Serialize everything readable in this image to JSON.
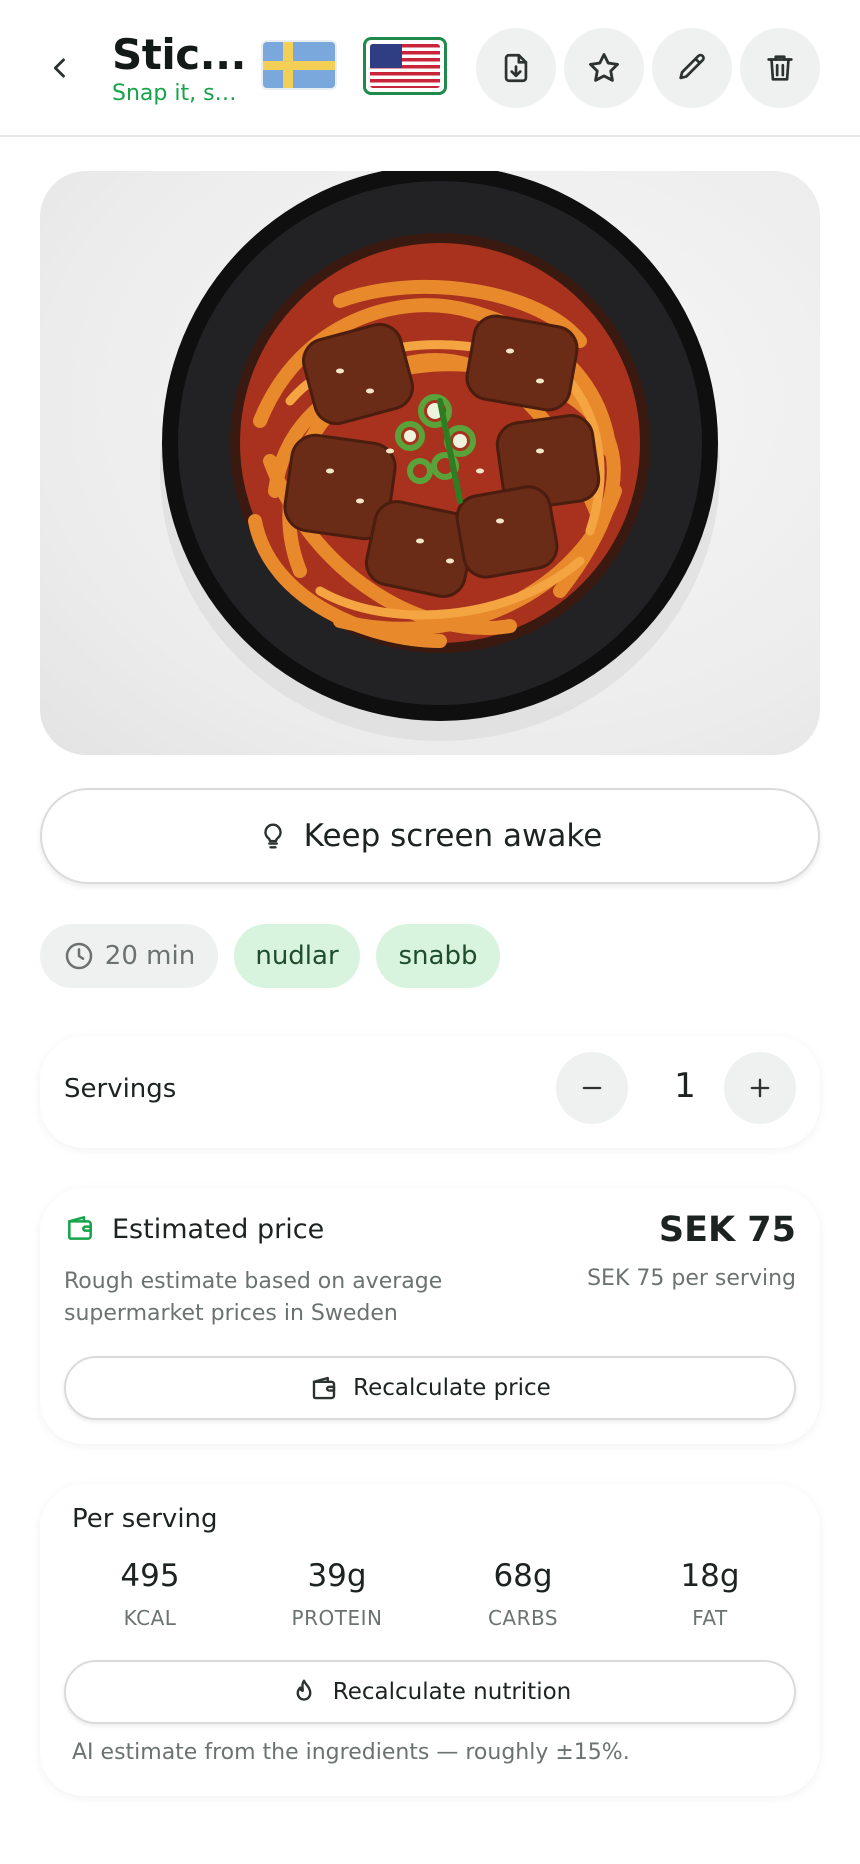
{
  "header": {
    "title": "Stic...",
    "subtitle": "Snap it, sa...",
    "languages": [
      "sv",
      "en-US"
    ],
    "selected_language": "en-US",
    "actions": [
      "download-icon",
      "star-icon",
      "pencil-icon",
      "trash-icon"
    ]
  },
  "hero": {
    "icon": "recipe-photo"
  },
  "awake": {
    "label": "Keep screen awake",
    "icon": "lightbulb-icon"
  },
  "chips": {
    "time": "20 min",
    "tags": [
      "nudlar",
      "snabb"
    ]
  },
  "servings": {
    "label": "Servings",
    "count": "1"
  },
  "price": {
    "title": "Estimated price",
    "value": "SEK 75",
    "note": "Rough estimate based on average supermarket prices in Sweden",
    "per_serving": "SEK 75 per serving",
    "button": "Recalculate price"
  },
  "nutrition": {
    "title": "Per serving",
    "items": [
      {
        "value": "495",
        "label": "KCAL"
      },
      {
        "value": "39g",
        "label": "PROTEIN"
      },
      {
        "value": "68g",
        "label": "CARBS"
      },
      {
        "value": "18g",
        "label": "FAT"
      }
    ],
    "button": "Recalculate nutrition",
    "footnote": "AI estimate from the ingredients — roughly ±15%."
  },
  "colors": {
    "accent_green": "#16a34a",
    "chip_tag_bg": "#d8f3de",
    "neutral_bg": "#eff1f0"
  }
}
